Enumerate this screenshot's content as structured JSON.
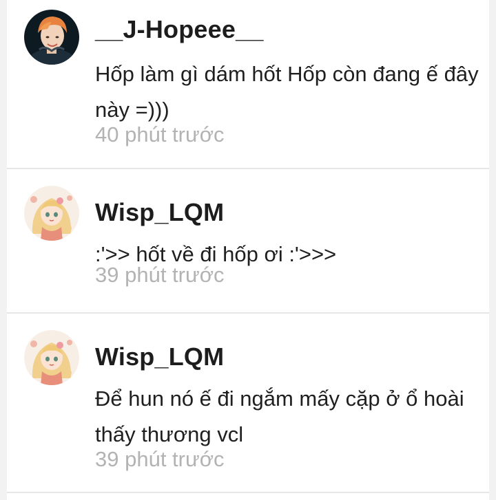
{
  "comments": [
    {
      "username": "__J-Hopeee__",
      "text": "Hốp làm gì dám hốt Hốp còn đang ế đây này =)))",
      "time": "40 phút trước",
      "avatar_icon": "person-avatar-icon"
    },
    {
      "username": "Wisp_LQM",
      "text": ":'>> hốt về đi hốp ơi :'>>>",
      "time": "39 phút trước",
      "avatar_icon": "anime-girl-avatar-icon"
    },
    {
      "username": "Wisp_LQM",
      "text": "Để hun nó ế đi ngắm mấy cặp ở ổ hoài thấy thương vcl",
      "time": "39 phút trước",
      "avatar_icon": "anime-girl-avatar-icon"
    }
  ],
  "colors": {
    "background": "#f2f2f2",
    "card": "#ffffff",
    "username": "#1d1d1d",
    "text": "#1f1f1f",
    "timestamp": "#b3b3b3",
    "divider": "#e6e6e6"
  }
}
